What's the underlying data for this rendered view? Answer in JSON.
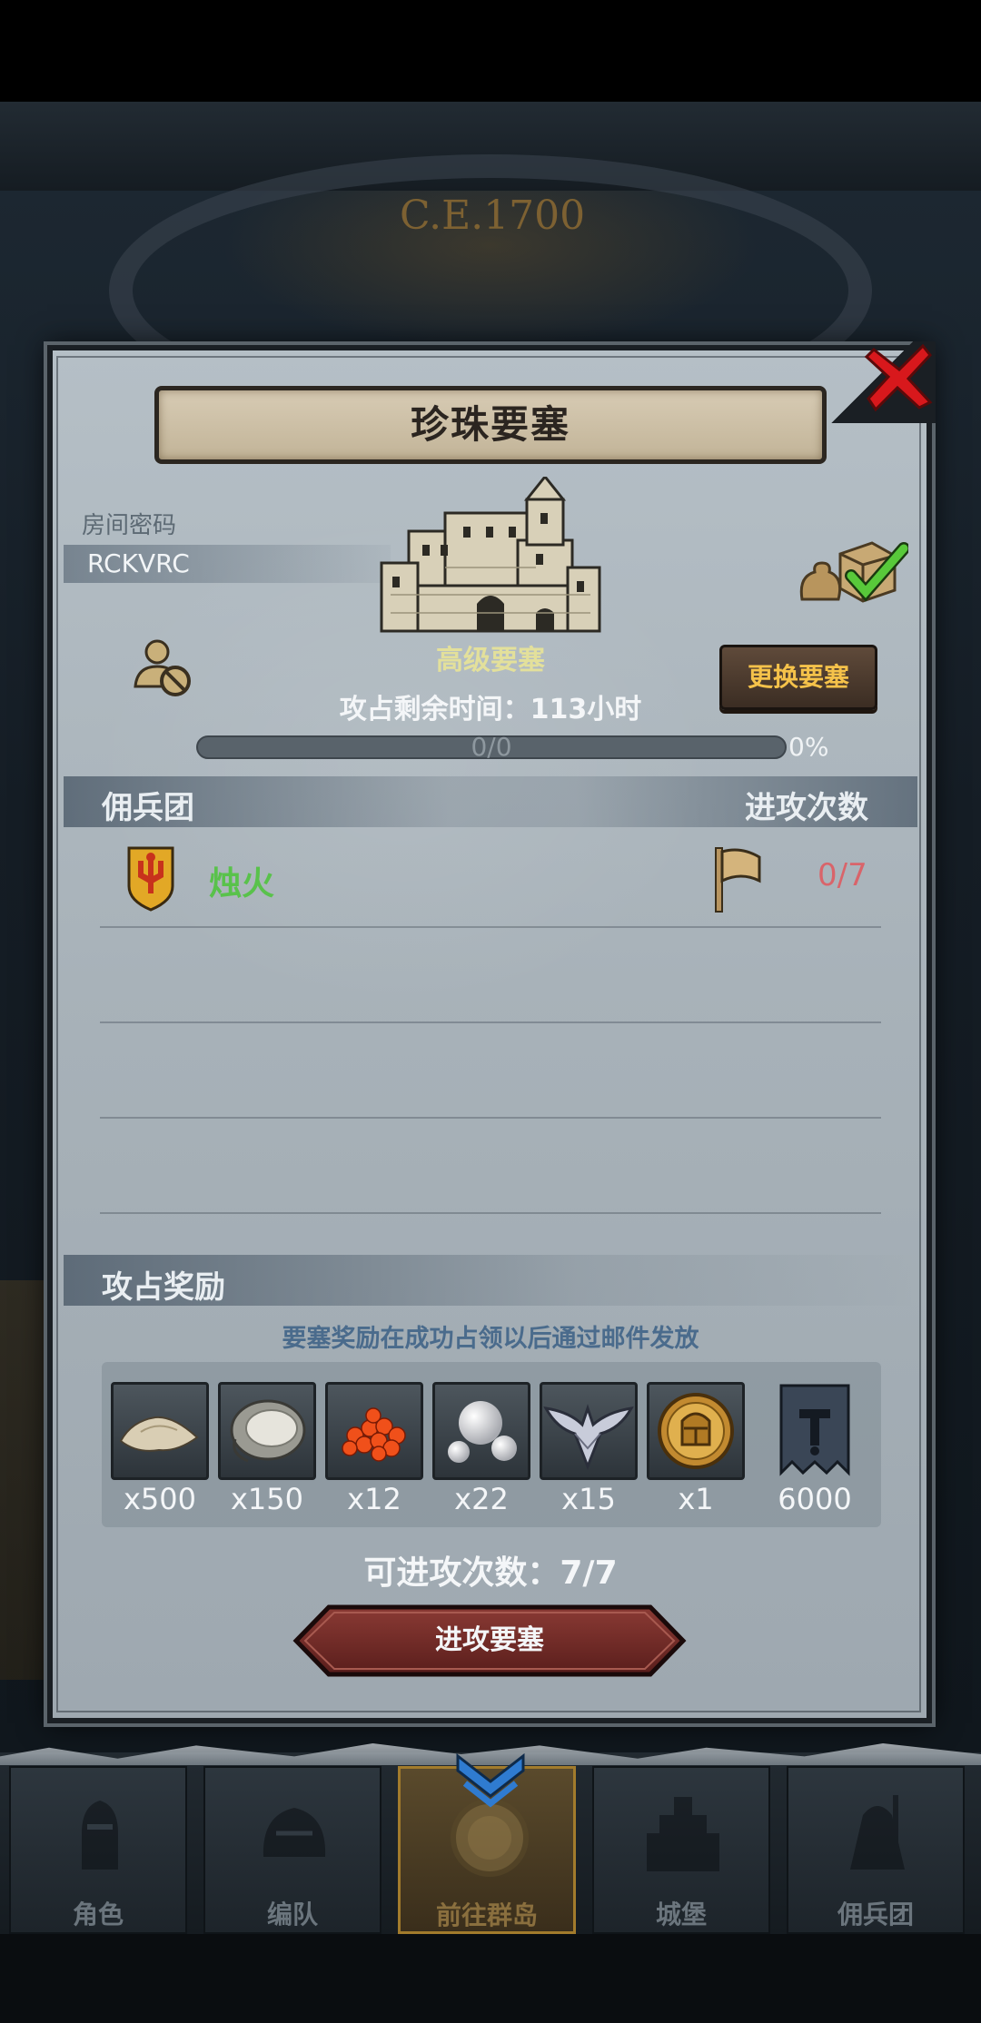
{
  "background": {
    "era_label": "C.E.1700"
  },
  "dialog": {
    "title": "珍珠要塞",
    "room_password_label": "房间密码",
    "room_code": "RCKVRC",
    "fortress_level": "高级要塞",
    "change_fortress_label": "更换要塞",
    "capture_time_text": "攻占剩余时间：113小时",
    "progress": {
      "count_text": "0/0",
      "percent_text": "0%",
      "fraction": 0
    },
    "mercenary_section": {
      "header": "佣兵团",
      "attack_count_header": "进攻次数",
      "rows": [
        {
          "name": "烛火",
          "attacks": "0/7"
        }
      ]
    },
    "reward_section": {
      "header": "攻占奖励",
      "note": "要塞奖励在成功占领以后通过邮件发放",
      "items": [
        {
          "icon": "sand-pile-icon",
          "qty": "x500"
        },
        {
          "icon": "oyster-icon",
          "qty": "x150"
        },
        {
          "icon": "roe-icon",
          "qty": "x12"
        },
        {
          "icon": "pearl-icon",
          "qty": "x22"
        },
        {
          "icon": "winged-emblem-icon",
          "qty": "x15"
        },
        {
          "icon": "knight-medal-icon",
          "qty": "x1"
        },
        {
          "icon": "guild-banner-icon",
          "qty": "6000"
        }
      ]
    },
    "attempts_text": "可进攻次数：7/7",
    "attack_button_label": "进攻要塞"
  },
  "nav": {
    "items": [
      {
        "label": "角色",
        "icon": "knight-icon",
        "active": false
      },
      {
        "label": "编队",
        "icon": "helmet-icon",
        "active": false
      },
      {
        "label": "前往群岛",
        "icon": "compass-icon",
        "active": true
      },
      {
        "label": "城堡",
        "icon": "castle-icon",
        "active": false
      },
      {
        "label": "佣兵团",
        "icon": "mercenary-icon",
        "active": false
      }
    ]
  },
  "colors": {
    "guild_name": "#59c24b",
    "attack_count": "#d9646a",
    "change_button_text": "#f5c24a",
    "reward_note": "#4a6b8c"
  }
}
